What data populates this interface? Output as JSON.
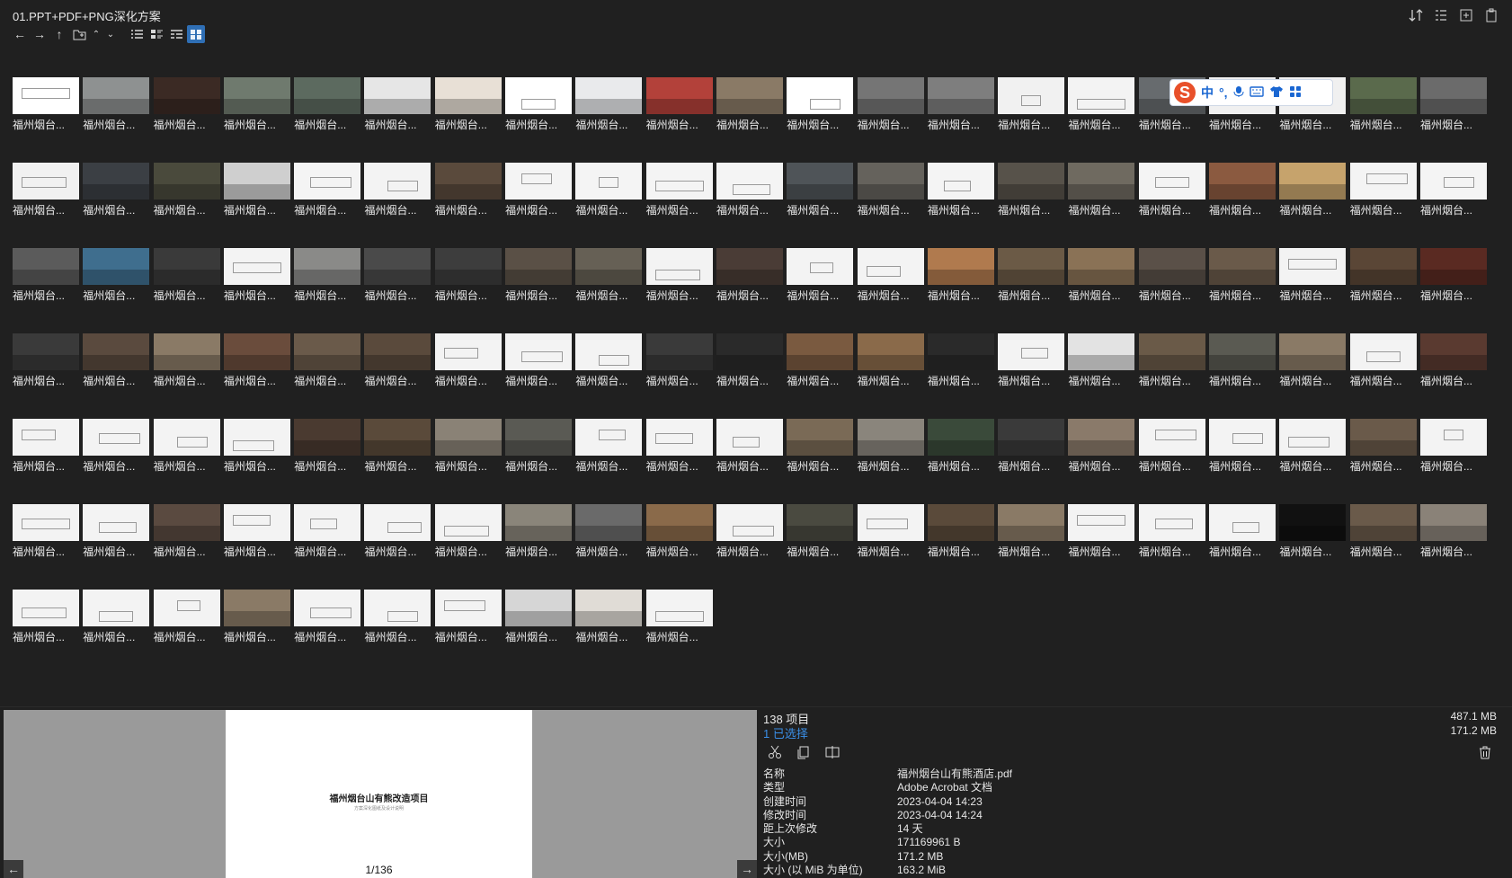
{
  "window": {
    "title": "01.PPT+PDF+PNG深化方案"
  },
  "toolbar": {
    "back": "←",
    "forward": "→",
    "up": "↑",
    "new_folder": "⧉",
    "sort_up": "⌃",
    "sort_down": "⌄"
  },
  "ime": {
    "label": "中",
    "punct": "°,",
    "mic": "🎤",
    "kbd": "⌨",
    "skin": "👕",
    "grid": "▦"
  },
  "files": {
    "label": "福州烟台...",
    "ppt_label": "福州烟台...",
    "selected_label": "福州烟台...",
    "thumbs": [
      "#ffffff",
      "#8e9191",
      "#3b2a24",
      "#6f7a6e",
      "#5c6a5f",
      "#e6e6e6",
      "#e8e0d6",
      "#ffffff",
      "#e9eaec",
      "#b3413a",
      "#8a7a66",
      "#ffffff",
      "#757575",
      "#7e7e7e",
      "#f1f1f1",
      "#f3f3f3",
      "#676b6e",
      "#f0f0f0",
      "#f0f0f0",
      "#5a6a4c",
      "#6b6b6b",
      "#f1f1f1",
      "#3b3f44",
      "#4a4a3c",
      "#cfcfcf",
      "#f4f4f4",
      "#f3f3f3",
      "#5a4a3c",
      "#f4f4f4",
      "#f4f4f4",
      "#f4f4f4",
      "#f4f4f4",
      "#4f5458",
      "#65625c",
      "#f4f4f4",
      "#57524a",
      "#6f6a60",
      "#f4f4f4",
      "#8b5a40",
      "#c6a36c",
      "#f4f4f4",
      "#f4f4f4",
      "#5b5b5b",
      "#3f6e8e",
      "#3a3a3a",
      "#f3f3f3",
      "#8a8a88",
      "#4a4a4a",
      "#3d3d3d",
      "#5a5046",
      "#666055",
      "#f3f3f3",
      "#4a3c36",
      "#f3f3f3",
      "#f3f3f3",
      "#b07a4e",
      "#6b5a46",
      "#8a7256",
      "#5a5048",
      "#6a5a4a",
      "#f3f3f3",
      "#5a4636",
      "#5a2a22",
      "#3a3a3a",
      "#5a4a3e",
      "#8a7a66",
      "#6a4c3c",
      "#6a5a4a",
      "#5a4a3c",
      "#f3f3f3",
      "#f3f3f3",
      "#f3f3f3",
      "#3a3a3a",
      "#2a2a2a",
      "#7a5a40",
      "#8a6a4a",
      "#2a2a2a",
      "#f3f3f3",
      "#e3e3e3",
      "#6a5a48",
      "#5a5a52",
      "#8a7a66",
      "#f3f3f3",
      "#5a3a30",
      "#f3f3f3",
      "#f3f3f3",
      "#f3f3f3",
      "#f3f3f3",
      "#4a3a30",
      "#5a4a3a",
      "#8a8276",
      "#5a5a54",
      "#f3f3f3",
      "#f3f3f3",
      "#f3f3f3",
      "#7a6a56",
      "#8a857c",
      "#3a4a3a",
      "#3a3a3a",
      "#8a7a6a",
      "#f3f3f3",
      "#f3f3f3",
      "#f3f3f3",
      "#6a5a4a",
      "#f3f3f3",
      "#f3f3f3",
      "#f3f3f3",
      "#5a4a40",
      "#f3f3f3",
      "#f3f3f3",
      "#f3f3f3",
      "#f3f3f3",
      "#8a857a",
      "#6a6a6a",
      "#8a6a4a",
      "#f3f3f3",
      "#4a4a40",
      "#f3f3f3",
      "#5a4a3a",
      "#8a7a66",
      "#f3f3f3",
      "#f3f3f3",
      "#f3f3f3",
      "#111111",
      "#6a5a4a",
      "#8a8278",
      "#f3f3f3",
      "#f3f3f3",
      "#f3f3f3",
      "#8a7a66",
      "#f3f3f3",
      "#f3f3f3",
      "#f3f3f3",
      "#d6d6d6",
      "#e0dcd6",
      "#f3f3f3"
    ],
    "selected_index": 136,
    "ppt_index": 137
  },
  "status": {
    "item_count": "138 项目",
    "selected_count": "1 已选择",
    "total_size": "487.1 MB",
    "selected_size": "171.2 MB"
  },
  "preview": {
    "title": "福州烟台山有熊改造项目",
    "subtitle": "方案深化图纸及设计说明",
    "page": "1/136"
  },
  "props": [
    {
      "k": "名称",
      "v": "福州烟台山有熊酒店.pdf"
    },
    {
      "k": "类型",
      "v": "Adobe Acrobat 文档"
    },
    {
      "k": "创建时间",
      "v": "2023-04-04  14:23"
    },
    {
      "k": "修改时间",
      "v": "2023-04-04  14:24"
    },
    {
      "k": "距上次修改",
      "v": "14 天"
    },
    {
      "k": "大小",
      "v": "171169961 B"
    },
    {
      "k": "大小(MB)",
      "v": "171.2 MB"
    },
    {
      "k": "大小 (以 MiB 为单位)",
      "v": "163.2 MiB"
    }
  ]
}
